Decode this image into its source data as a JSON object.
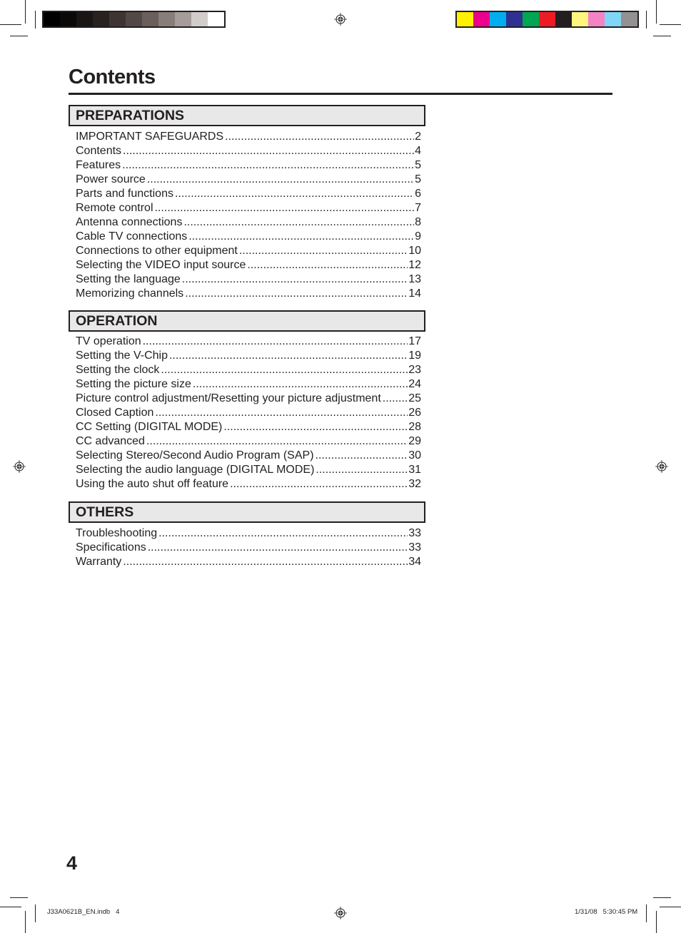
{
  "printer_marks": {
    "grayscale_swatches": [
      "#000000",
      "#0b0908",
      "#191514",
      "#27221f",
      "#3e3532",
      "#524846",
      "#6b5f5b",
      "#877d79",
      "#a69d9a",
      "#d2cccb",
      "#ffffff"
    ],
    "color_swatches": [
      "#fff200",
      "#ec008c",
      "#00aeef",
      "#2e3192",
      "#00a651",
      "#ed1c24",
      "#231f20",
      "#fff57f",
      "#f483c6",
      "#80d6f7",
      "#939191"
    ]
  },
  "title": "Contents",
  "sections": [
    {
      "heading": "PREPARATIONS",
      "items": [
        {
          "label": "IMPORTANT SAFEGUARDS",
          "page": "2"
        },
        {
          "label": "Contents",
          "page": "4"
        },
        {
          "label": "Features",
          "page": "5"
        },
        {
          "label": "Power source",
          "page": "5"
        },
        {
          "label": "Parts and functions",
          "page": "6"
        },
        {
          "label": "Remote control",
          "page": "7"
        },
        {
          "label": "Antenna connections",
          "page": "8"
        },
        {
          "label": "Cable TV connections",
          "page": "9"
        },
        {
          "label": "Connections to other equipment",
          "page": "10"
        },
        {
          "label": "Selecting the VIDEO input source",
          "page": "12"
        },
        {
          "label": "Setting the language",
          "page": "13"
        },
        {
          "label": "Memorizing channels",
          "page": "14"
        }
      ]
    },
    {
      "heading": "OPERATION",
      "items": [
        {
          "label": "TV operation",
          "page": "17"
        },
        {
          "label": "Setting the V-Chip",
          "page": "19"
        },
        {
          "label": "Setting the clock",
          "page": "23"
        },
        {
          "label": "Setting the picture size",
          "page": "24"
        },
        {
          "label": "Picture control adjustment/Resetting your picture adjustment",
          "page": "25"
        },
        {
          "label": "Closed Caption",
          "page": "26"
        },
        {
          "label": "CC Setting (DIGITAL MODE)",
          "page": "28"
        },
        {
          "label": "CC advanced",
          "page": "29"
        },
        {
          "label": "Selecting Stereo/Second Audio Program (SAP)",
          "page": "30"
        },
        {
          "label": "Selecting the audio language (DIGITAL MODE)",
          "page": "31"
        },
        {
          "label": "Using the auto shut off feature",
          "page": "32"
        }
      ]
    },
    {
      "heading": "OTHERS",
      "items": [
        {
          "label": "Troubleshooting",
          "page": "33"
        },
        {
          "label": "Specifications",
          "page": "33"
        },
        {
          "label": "Warranty",
          "page": "34"
        }
      ]
    }
  ],
  "page_number": "4",
  "slug": {
    "file": "J33A0621B_EN.indb   4",
    "datetime": "1/31/08   5:30:45 PM"
  }
}
